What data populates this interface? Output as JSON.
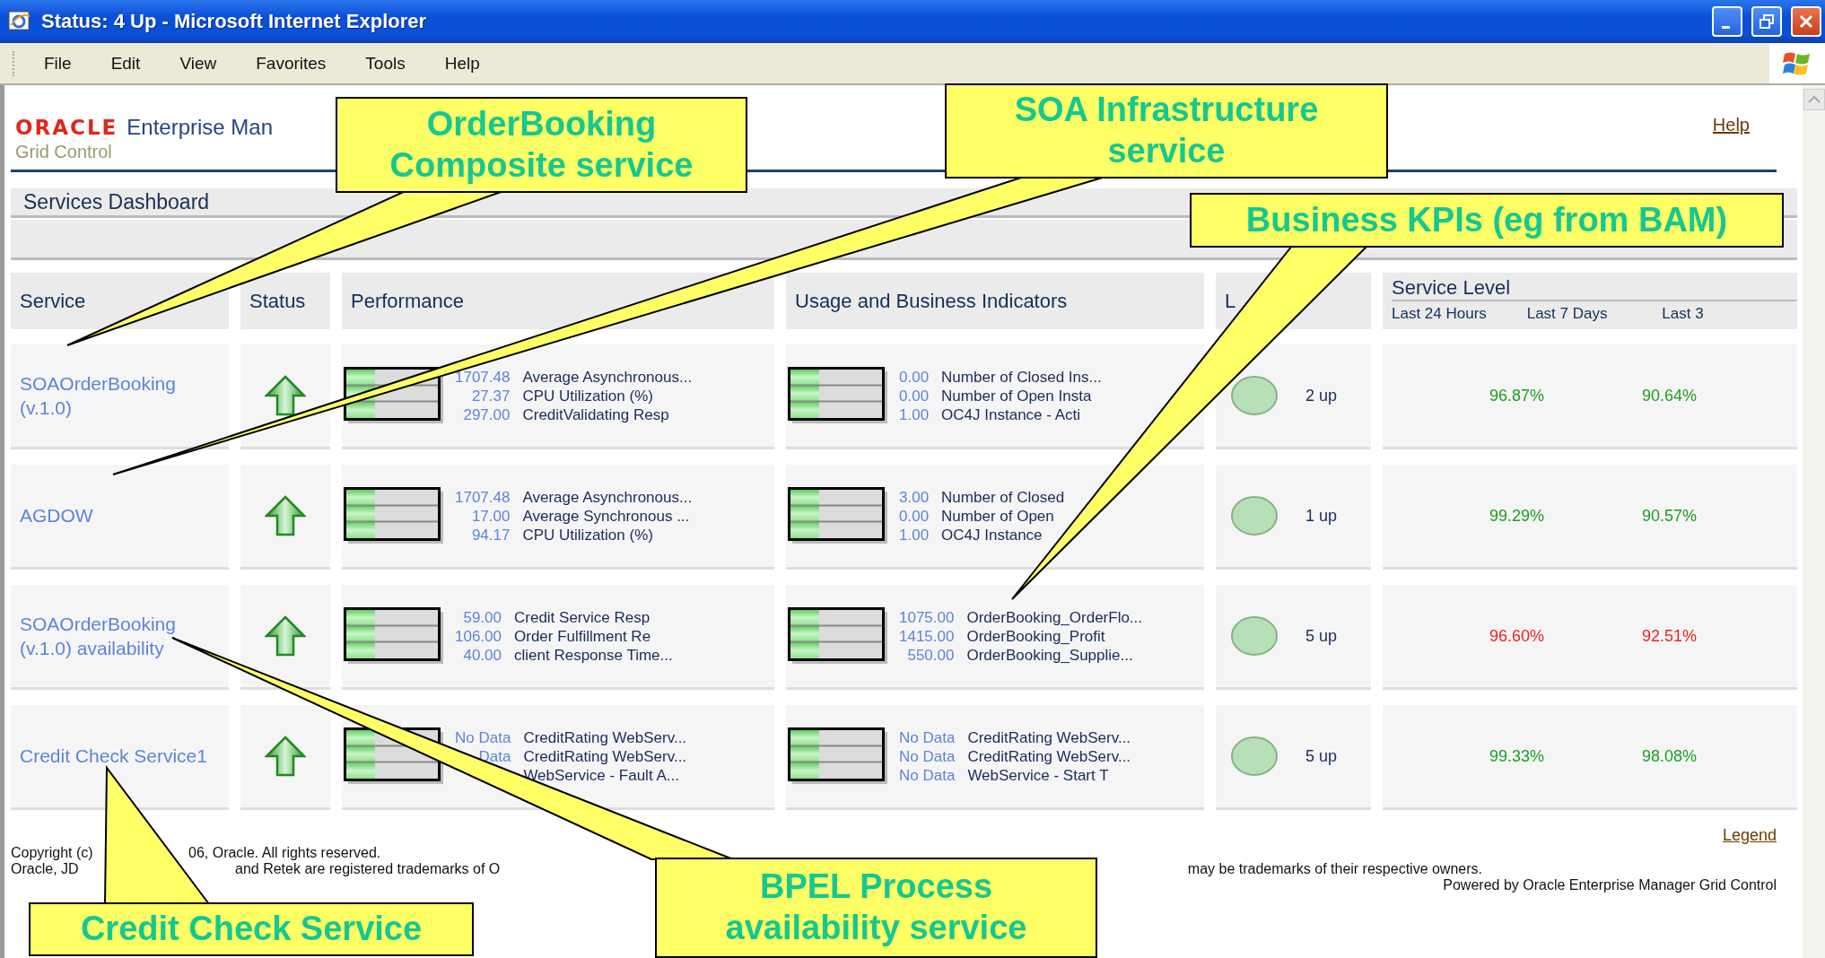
{
  "window": {
    "title": "Status: 4 Up - Microsoft Internet Explorer"
  },
  "menu": [
    "File",
    "Edit",
    "View",
    "Favorites",
    "Tools",
    "Help"
  ],
  "header": {
    "logo": "ORACLE",
    "product": "Enterprise Man",
    "subtitle": "Grid Control",
    "help": "Help"
  },
  "dashboard": {
    "title": "Services Dashboard",
    "columns": [
      "Service",
      "Status",
      "Performance",
      "Usage and Business Indicators",
      "L"
    ],
    "service_level": {
      "title": "Service Level",
      "columns": [
        "Last 24 Hours",
        "Last 7 Days",
        "Last 3"
      ]
    },
    "rows": [
      {
        "service": "SOAOrderBooking (v.1.0)",
        "status_up": true,
        "components_up": true,
        "members": "2 up",
        "performance": [
          {
            "value": "1707.48",
            "metric": "Average Asynchronous..."
          },
          {
            "value": "27.37",
            "metric": "CPU Utilization (%)"
          },
          {
            "value": "297.00",
            "metric": "CreditValidating Resp"
          }
        ],
        "usage": [
          {
            "value": "0.00",
            "metric": "Number of Closed Ins..."
          },
          {
            "value": "0.00",
            "metric": "Number of Open Insta"
          },
          {
            "value": "1.00",
            "metric": "OC4J Instance - Acti"
          }
        ],
        "service_level": [
          {
            "text": "96.87%",
            "met": true
          },
          {
            "text": "90.64%",
            "met": true
          }
        ]
      },
      {
        "service": "AGDOW",
        "status_up": true,
        "components_up": true,
        "members": "1 up",
        "performance": [
          {
            "value": "1707.48",
            "metric": "Average Asynchronous..."
          },
          {
            "value": "17.00",
            "metric": "Average Synchronous ..."
          },
          {
            "value": "94.17",
            "metric": "CPU Utilization (%)"
          }
        ],
        "usage": [
          {
            "value": "3.00",
            "metric": "Number of Closed"
          },
          {
            "value": "0.00",
            "metric": "Number of Open"
          },
          {
            "value": "1.00",
            "metric": "OC4J Instance"
          }
        ],
        "service_level": [
          {
            "text": "99.29%",
            "met": true
          },
          {
            "text": "90.57%",
            "met": true
          }
        ]
      },
      {
        "service": "SOAOrderBooking (v.1.0) availability",
        "status_up": true,
        "components_up": true,
        "members": "5 up",
        "performance": [
          {
            "value": "59.00",
            "metric": "Credit Service Resp"
          },
          {
            "value": "106.00",
            "metric": "Order Fulfillment Re"
          },
          {
            "value": "40.00",
            "metric": "client Response Time..."
          }
        ],
        "usage": [
          {
            "value": "1075.00",
            "metric": "OrderBooking_OrderFlo..."
          },
          {
            "value": "1415.00",
            "metric": "OrderBooking_Profit"
          },
          {
            "value": "550.00",
            "metric": "OrderBooking_Supplie..."
          }
        ],
        "service_level": [
          {
            "text": "96.60%",
            "met": false
          },
          {
            "text": "92.51%",
            "met": false
          }
        ]
      },
      {
        "service": "Credit Check Service1",
        "status_up": true,
        "components_up": true,
        "members": "5 up",
        "performance": [
          {
            "value": "No Data",
            "metric": "CreditRating WebServ..."
          },
          {
            "value": "Data",
            "metric": "CreditRating WebServ..."
          },
          {
            "metric": "WebService - Fault A..."
          }
        ],
        "usage": [
          {
            "value": "No Data",
            "metric": "CreditRating WebServ..."
          },
          {
            "value": "No Data",
            "metric": "CreditRating WebServ..."
          },
          {
            "value": "No Data",
            "metric": "WebService - Start T"
          }
        ],
        "service_level": [
          {
            "text": "99.33%",
            "met": true
          },
          {
            "text": "98.08%",
            "met": true
          }
        ]
      }
    ]
  },
  "footer": {
    "legend": "Legend",
    "copyright_left": "Copyright (c)",
    "copyright_right": "06, Oracle. All rights reserved.",
    "trademark_left": "Oracle, JD",
    "trademark_middle": "and Retek are registered trademarks of O",
    "trademark_right": "may be trademarks of their respective owners.",
    "powered": "Powered by Oracle Enterprise Manager Grid Control"
  },
  "callouts": [
    {
      "lines": [
        "OrderBooking",
        "Composite service"
      ]
    },
    {
      "lines": [
        "SOA Infrastructure",
        "service"
      ]
    },
    {
      "lines": [
        "Business KPIs (eg from BAM)"
      ]
    },
    {
      "lines": [
        "Credit Check Service"
      ]
    },
    {
      "lines": [
        "BPEL Process",
        "availability service"
      ]
    }
  ]
}
